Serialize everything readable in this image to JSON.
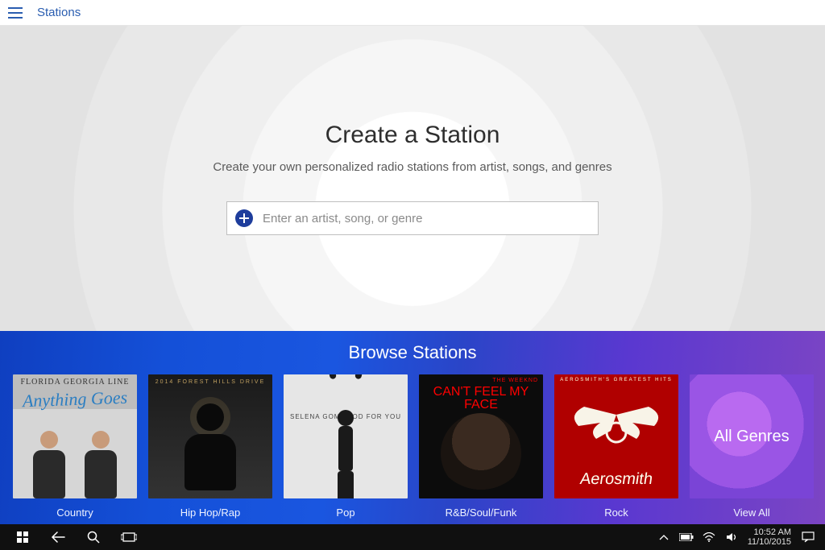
{
  "topbar": {
    "title": "Stations"
  },
  "hero": {
    "heading": "Create a Station",
    "subheading": "Create your own personalized radio stations from artist, songs, and genres",
    "placeholder": "Enter an artist, song, or genre"
  },
  "browse": {
    "heading": "Browse Stations",
    "tiles": [
      {
        "label": "Country",
        "art": {
          "band": "FLORIDA GEORGIA LINE",
          "script": "Anything Goes"
        }
      },
      {
        "label": "Hip Hop/Rap",
        "art": {
          "txt": "2014 FOREST HILLS DRIVE"
        }
      },
      {
        "label": "Pop",
        "art": {
          "artist": "SELENA GOMEZ",
          "title": "GOOD FOR YOU"
        }
      },
      {
        "label": "R&B/Soul/Funk",
        "art": {
          "top": "THE WEEKND",
          "big": "CAN'T FEEL MY FACE"
        }
      },
      {
        "label": "Rock",
        "art": {
          "top": "AEROSMITH'S GREATEST HITS",
          "logo": "Aerosmith"
        }
      },
      {
        "label": "View All",
        "art": {
          "text": "All Genres"
        }
      }
    ]
  },
  "taskbar": {
    "time": "10:52 AM",
    "date": "11/10/2015"
  }
}
